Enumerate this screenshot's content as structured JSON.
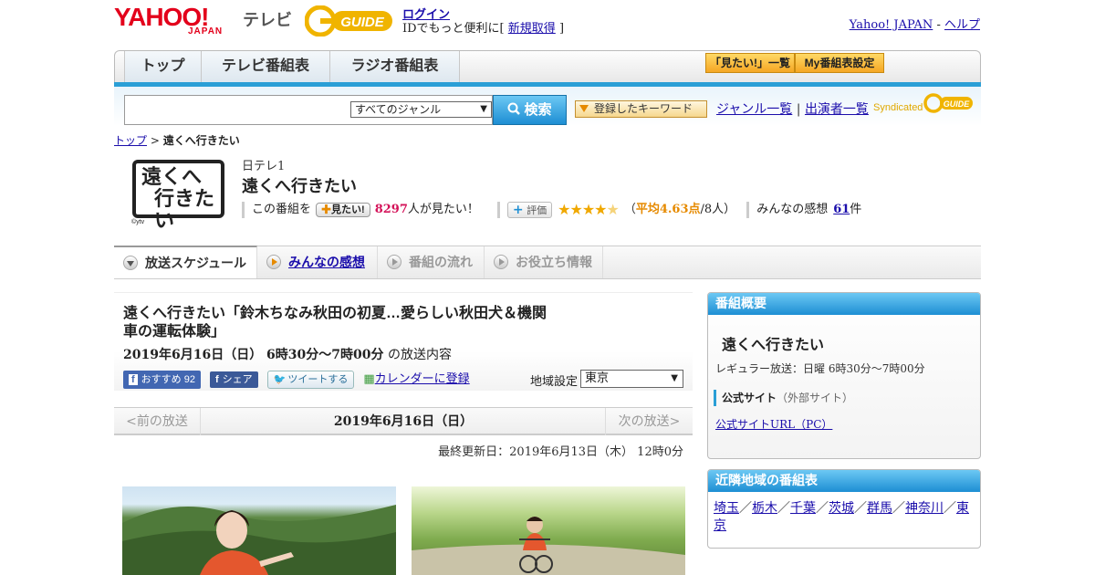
{
  "header": {
    "yahoo": "YAHOO!",
    "japan": "JAPAN",
    "tv": "テレビ",
    "gguide": "G-GUIDE",
    "login": "ログイン",
    "login_sub_prefix": "IDでもっと便利に[",
    "signup": "新規取得",
    "login_sub_suffix": "]",
    "yahoo_japan_link": "Yahoo! JAPAN",
    "separator": "-",
    "help_link": "ヘルプ"
  },
  "nav": {
    "tabs": [
      "トップ",
      "テレビ番組表",
      "ラジオ番組表"
    ],
    "mitai_list": "「見たい!」一覧",
    "my_schedule": "My番組表設定"
  },
  "search": {
    "genre_selected": "すべてのジャンル",
    "button": "検索",
    "keyword_button": "登録したキーワード",
    "genre_list": "ジャンル一覧",
    "divider": "|",
    "performer_list": "出演者一覧",
    "syndicated": "Syndicated"
  },
  "breadcrumb": {
    "top": "トップ",
    "sep": ">",
    "current": "遠くへ行きたい"
  },
  "program": {
    "logo_text_1": "遠くへ",
    "logo_text_2": "行きたい",
    "logo_credit": "©ytv",
    "channel": "日テレ1",
    "title": "遠くへ行きたい",
    "this_program": "この番組を",
    "mitai_btn": "見たい!",
    "mitai_count": "8297",
    "mitai_suffix": "人が見たい！",
    "rating_btn": "評価",
    "rating_stars": 4.63,
    "avg_open": "（",
    "avg_label": "平均4.63点",
    "avg_suffix": "/8人）",
    "reviews_label": "みんなの感想",
    "reviews_count": "61",
    "reviews_suffix": "件"
  },
  "subtabs": [
    "放送スケジュール",
    "みんなの感想",
    "番組の流れ",
    "お役立ち情報"
  ],
  "episode": {
    "title": "遠くへ行きたい「鈴木ちなみ秋田の初夏…愛らしい秋田犬＆機関車の運転体験」",
    "date_time": "2019年6月16日（日） 6時30分～7時00分",
    "date_suffix": "の放送内容",
    "fb_recommend": "おすすめ",
    "fb_count": "92",
    "fb_share": "シェア",
    "tweet": "ツイートする",
    "calendar": "カレンダーに登録",
    "region_label": "地域設定",
    "region_value": "東京"
  },
  "pager": {
    "prev": "<前の放送",
    "current": "2019年6月16日（日）",
    "next": "次の放送>"
  },
  "updated": "最終更新日：2019年6月13日（木） 12時0分",
  "overview": {
    "header": "番組概要",
    "title": "遠くへ行きたい",
    "regular": "レギュラー放送：日曜 6時30分～7時00分",
    "official_site": "公式サイト",
    "external": "（外部サイト）",
    "official_url": "公式サイトURL（PC）"
  },
  "nearby": {
    "header": "近隣地域の番組表",
    "regions": [
      "埼玉",
      "栃木",
      "千葉",
      "茨城",
      "群馬",
      "神奈川",
      "東京"
    ],
    "sep": "／"
  },
  "colors": {
    "accent_blue": "#2a9fd6",
    "yahoo_red": "#e3001b",
    "orange": "#f5a623",
    "star": "#f0a800"
  }
}
